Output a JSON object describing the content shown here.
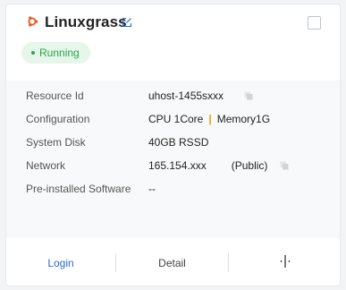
{
  "instance": {
    "name": "Linuxgrass",
    "os_icon": "ubuntu-icon",
    "status": "Running",
    "status_color": "#2fa54a",
    "details": {
      "resource_id": {
        "label": "Resource Id",
        "value": "uhost-1455sxxx"
      },
      "configuration": {
        "label": "Configuration",
        "cpu": "CPU 1Core",
        "memory": "Memory1G"
      },
      "system_disk": {
        "label": "System Disk",
        "value": "40GB RSSD"
      },
      "network": {
        "label": "Network",
        "ip": "165.154.xxx",
        "type": "(Public)"
      },
      "software": {
        "label": "Pre-installed Software",
        "value": "--"
      }
    }
  },
  "actions": {
    "login": "Login",
    "detail": "Detail",
    "more_icon": "more-icon"
  },
  "colors": {
    "link": "#2a6ad1",
    "accent_orange": "#e3a600",
    "os_icon_color": "#e95420"
  }
}
